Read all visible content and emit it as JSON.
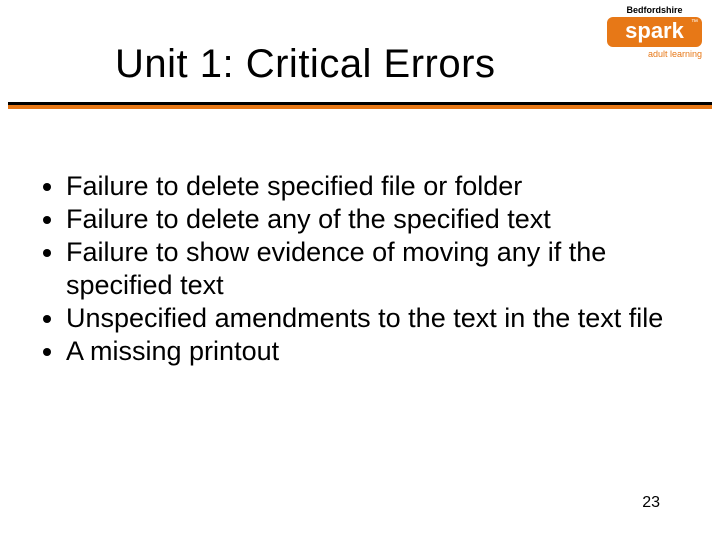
{
  "logo": {
    "top": "Bedfordshire",
    "word": "spark",
    "tm": "™",
    "bottom": "adult learning"
  },
  "title": "Unit 1: Critical Errors",
  "bullets": {
    "b0": "Failure to delete specified file or folder",
    "b1": "Failure to delete any of the specified text",
    "b2": "Failure to show evidence of moving any if the specified text",
    "b3": "Unspecified amendments to the text in the text file",
    "b4": "A missing printout"
  },
  "page_number": "23"
}
